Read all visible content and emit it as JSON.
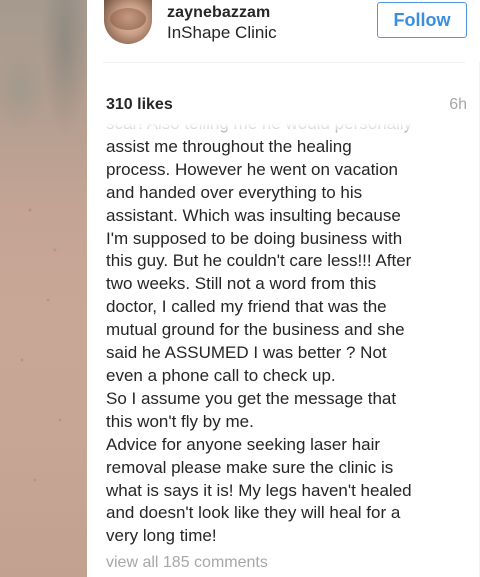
{
  "post": {
    "username": "zaynebazzam",
    "location": "InShape Clinic",
    "follow_label": "Follow",
    "likes": "310 likes",
    "time_ago": "6h",
    "caption_lines": [
      "scar! Also telling me he would personally",
      "assist me throughout the healing",
      "process. However he went on vacation",
      "and handed over everything to his",
      "assistant. Which was insulting because",
      "I'm supposed to be doing business with",
      "this guy. But he couldn't care less!!! After",
      "two weeks. Still not a word from this",
      "doctor, I called my friend that was the",
      "mutual ground for the business and she",
      "said he ASSUMED I was better ? Not",
      "even a phone call to check up.",
      "So I assume you get the message that",
      "this won't fly by me.",
      "Advice for anyone seeking laser hair",
      "removal please make sure the clinic is",
      "what is says it is! My legs haven't healed",
      "and doesn't look like they will heal for a",
      "very long time!"
    ],
    "view_comments_label": "view all 185 comments"
  },
  "colors": {
    "follow_accent": "#3a8ee0",
    "text_primary": "#262626",
    "text_muted": "#a5a7aa"
  },
  "icons": {
    "avatar": "profile-photo"
  }
}
